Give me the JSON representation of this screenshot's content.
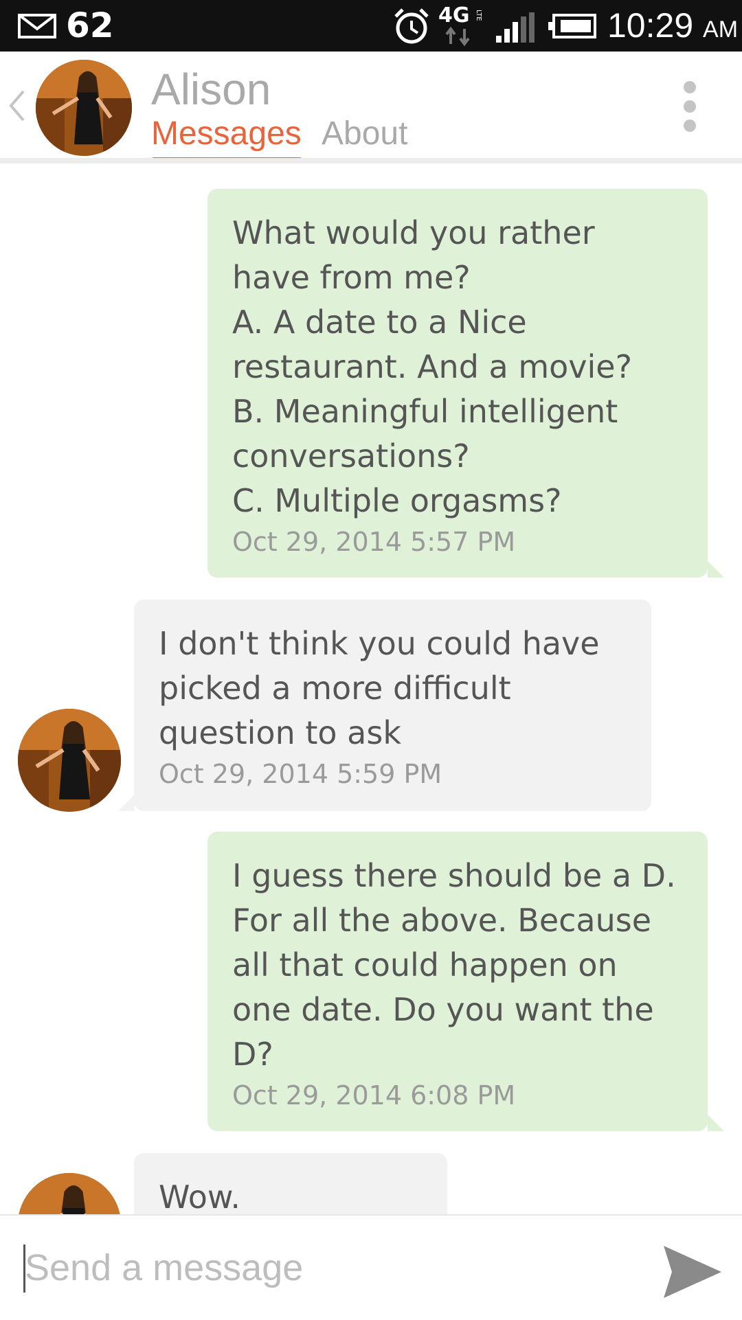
{
  "status_bar": {
    "mail_count": "62",
    "network": "4G",
    "network_sub": "LTE",
    "time": "10:29",
    "ampm": "AM"
  },
  "header": {
    "contact_name": "Alison",
    "tabs": [
      {
        "label": "Messages",
        "active": true
      },
      {
        "label": "About",
        "active": false
      }
    ]
  },
  "messages": [
    {
      "direction": "sent",
      "text": "What would you rather\nhave from me?\nA. A date to a Nice\nrestaurant. And a movie?\nB. Meaningful intelligent\nconversations?\nC. Multiple orgasms?",
      "timestamp": "Oct 29, 2014  5:57 PM"
    },
    {
      "direction": "received",
      "text": "I don't think you could have\npicked a more difficult\nquestion to ask",
      "timestamp": "Oct 29, 2014  5:59 PM"
    },
    {
      "direction": "sent",
      "text": "I guess there should be a D.\nFor all the above. Because\nall that could happen on\none date. Do you want the\nD?",
      "timestamp": "Oct 29, 2014  6:08 PM"
    },
    {
      "direction": "received",
      "text": "Wow."
    }
  ],
  "composer": {
    "placeholder": "Send a message"
  },
  "colors": {
    "accent": "#e8643a",
    "sent_bubble": "#dff1d7",
    "received_bubble": "#f2f2f2",
    "status_bar": "#111111"
  },
  "icons": {
    "status": [
      "mail-icon",
      "alarm-icon",
      "network-activity-icon",
      "signal-icon",
      "battery-icon"
    ],
    "header": [
      "back-chevron-icon",
      "overflow-menu-icon"
    ],
    "composer": [
      "send-icon"
    ]
  }
}
